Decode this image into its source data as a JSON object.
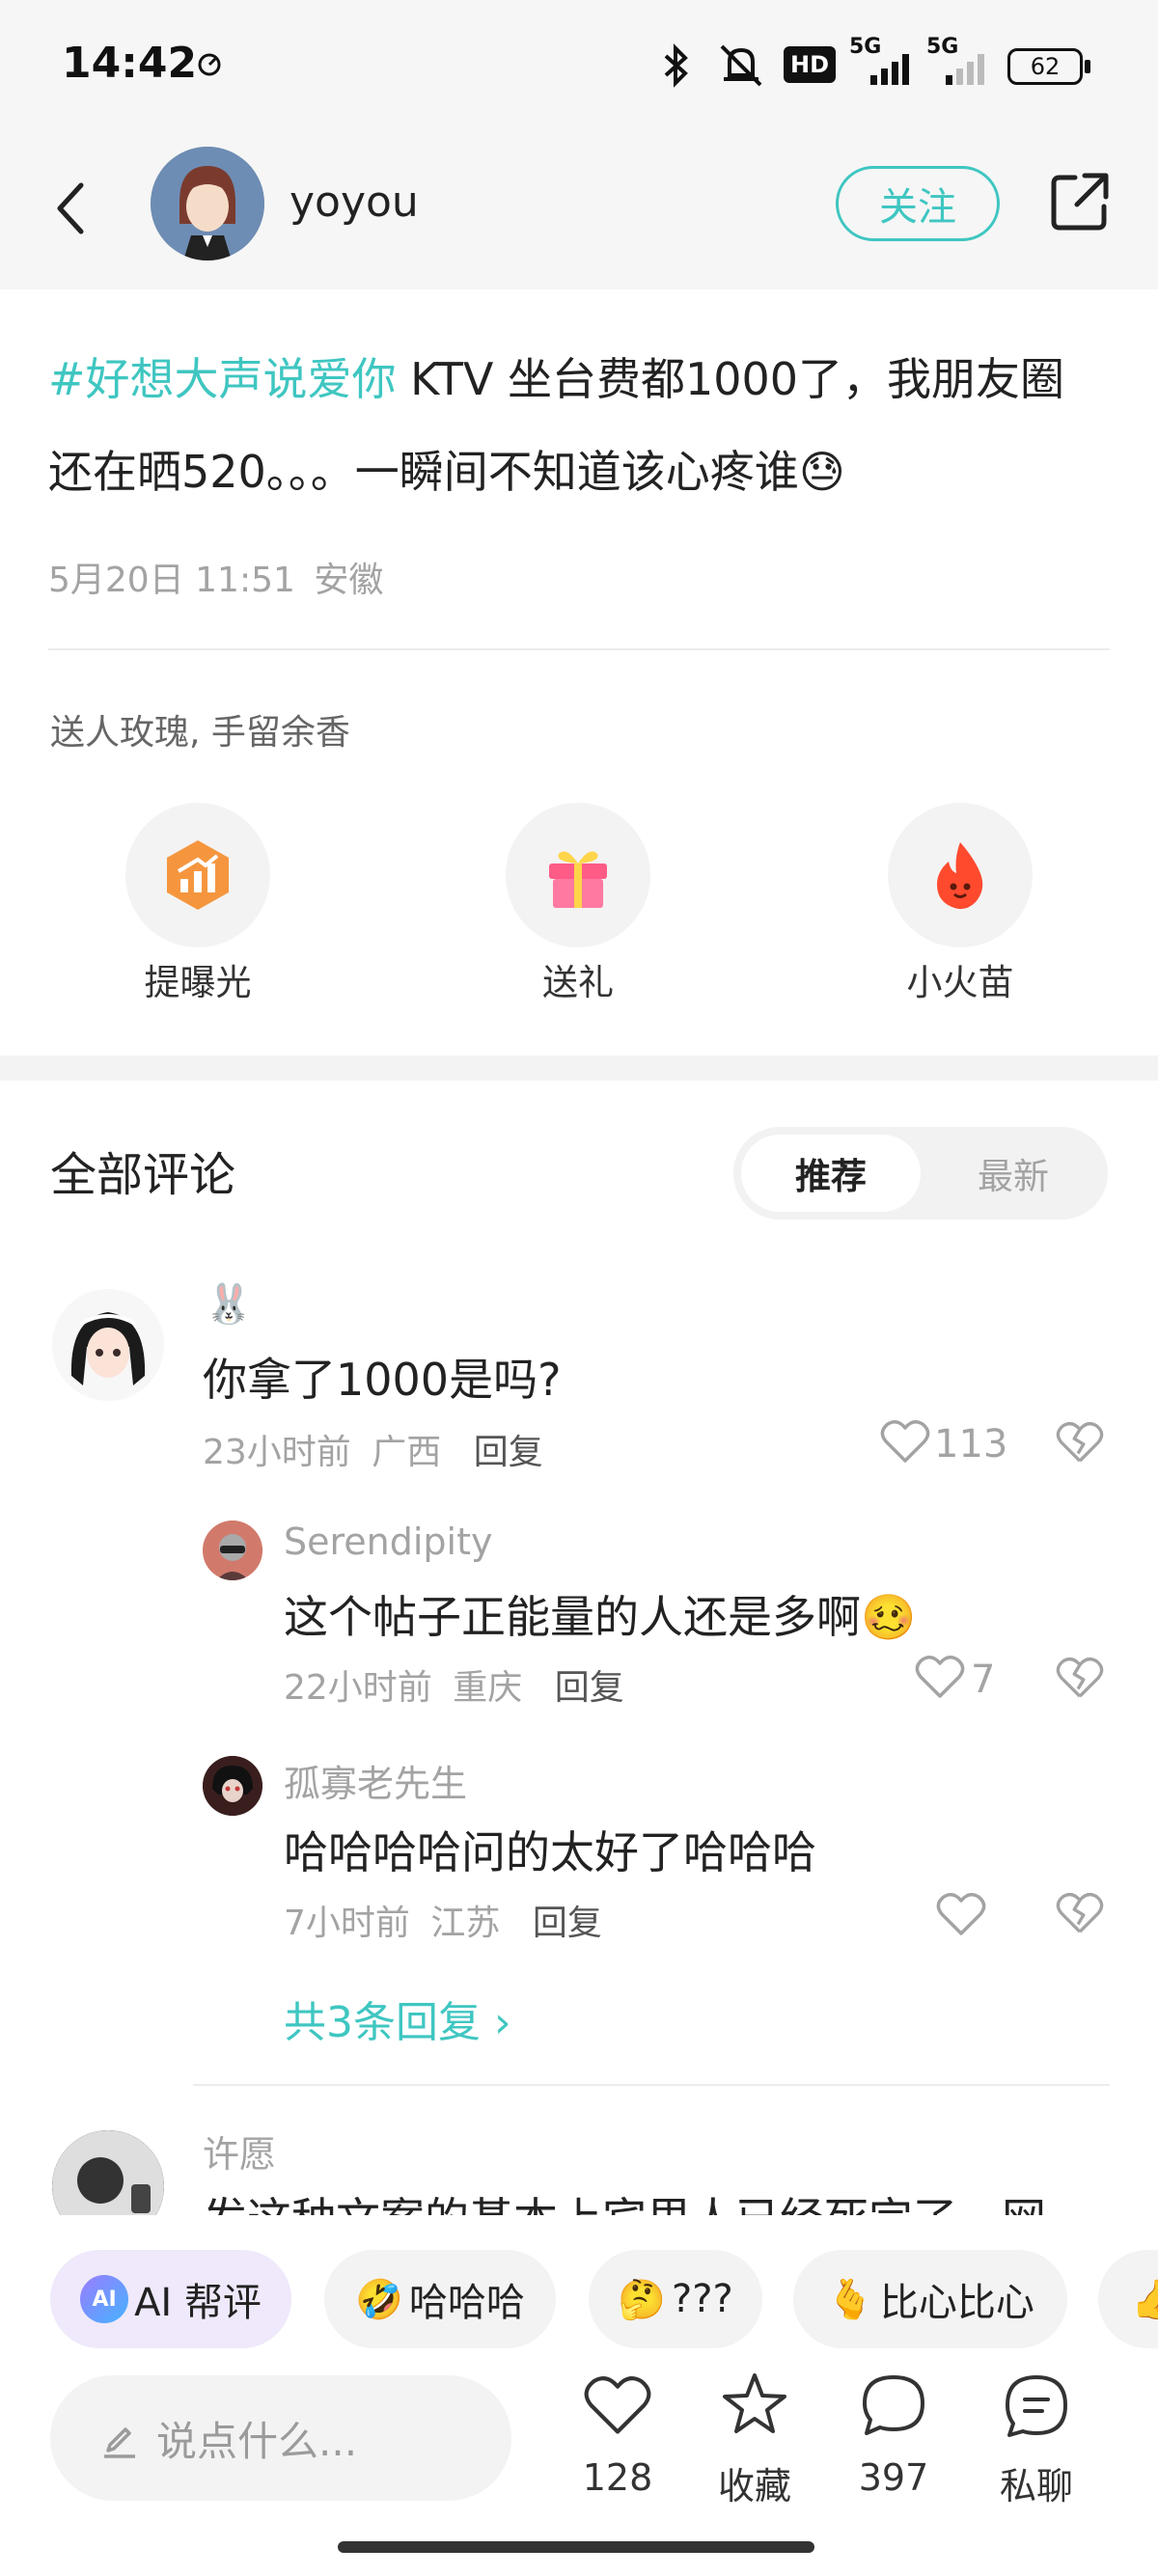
{
  "status_bar": {
    "time": "14:42",
    "network_1": "5G",
    "network_2": "5G",
    "hd": "HD",
    "battery": "62"
  },
  "header": {
    "username": "yoyou",
    "follow_label": "关注"
  },
  "post": {
    "hashtag": "#好想大声说爱你",
    "text_line1_rest": " KTV 坐台费都1000了，我朋友圈",
    "text_line2": "还在晒520。。。一瞬间不知道该心疼谁",
    "emoji": "😓",
    "date": "5月20日 11:51",
    "location": "安徽"
  },
  "gifts": {
    "title": "送人玫瑰, 手留余香",
    "items": [
      {
        "label": "提曝光",
        "icon": "exposure-boost-icon"
      },
      {
        "label": "送礼",
        "icon": "gift-box-icon"
      },
      {
        "label": "小火苗",
        "icon": "flame-icon"
      }
    ]
  },
  "comments_section": {
    "title": "全部评论",
    "sort_recommend": "推荐",
    "sort_latest": "最新"
  },
  "comments": [
    {
      "name_emoji": "🐰",
      "text": "你拿了1000是吗?",
      "time": "23小时前",
      "location": "广西",
      "reply": "回复",
      "likes": "113"
    }
  ],
  "replies": [
    {
      "name": "Serendipity",
      "text": "这个帖子正能量的人还是多啊",
      "emoji": "🥴",
      "time": "22小时前",
      "location": "重庆",
      "reply": "回复",
      "likes": "7"
    },
    {
      "name": "孤寡老先生",
      "text": "哈哈哈哈问的太好了哈哈哈",
      "time": "7小时前",
      "location": "江苏",
      "reply": "回复",
      "likes": ""
    }
  ],
  "more_replies": "共3条回复 ›",
  "next_comment": {
    "name": "许愿",
    "text_partial": "发这种文案的基本上宾里人已经死完了，网"
  },
  "quick_chips": [
    {
      "icon": "🤖",
      "label": "AI 帮评"
    },
    {
      "icon": "🤣",
      "label": "哈哈哈"
    },
    {
      "icon": "🤔",
      "label": "???"
    },
    {
      "icon": "🫰",
      "label": "比心比心"
    },
    {
      "icon": "👍",
      "label": ""
    }
  ],
  "bottom_bar": {
    "input_placeholder": "说点什么...",
    "likes": "128",
    "favorite": "收藏",
    "comments": "397",
    "message": "私聊"
  },
  "colors": {
    "accent": "#3fc6c1",
    "muted": "#a3a3a3",
    "text": "#222222"
  }
}
